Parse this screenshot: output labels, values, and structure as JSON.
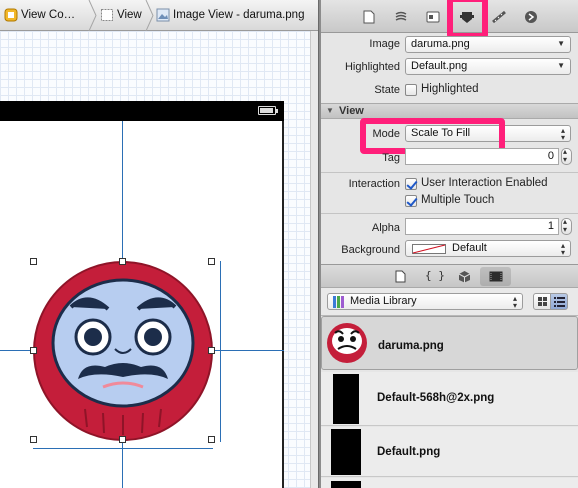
{
  "breadcrumb": [
    {
      "label": "View Co…"
    },
    {
      "label": "View"
    },
    {
      "label": "Image View - daruma.png"
    }
  ],
  "inspector": {
    "image_label": "Image",
    "image_value": "daruma.png",
    "highlighted_label": "Highlighted",
    "highlighted_value": "Default.png",
    "state_label": "State",
    "state_option": "Highlighted",
    "state_checked": false,
    "section_title": "View",
    "mode_label": "Mode",
    "mode_value": "Scale To Fill",
    "tag_label": "Tag",
    "tag_value": "0",
    "interaction_label": "Interaction",
    "user_interaction_label": "User Interaction Enabled",
    "user_interaction_checked": true,
    "multiple_touch_label": "Multiple Touch",
    "multiple_touch_checked": true,
    "alpha_label": "Alpha",
    "alpha_value": "1",
    "background_label": "Background",
    "background_value": "Default"
  },
  "library": {
    "source": "Media Library",
    "items": [
      {
        "name": "daruma.png",
        "selected": true
      },
      {
        "name": "Default-568h@2x.png",
        "selected": false
      },
      {
        "name": "Default.png",
        "selected": false
      }
    ]
  },
  "colors": {
    "highlight": "#ff1f7a",
    "guide": "#2b6fb5",
    "daruma_red": "#c41e3a",
    "daruma_face": "#b7cdf0"
  },
  "icons": [
    "file-inspector-icon",
    "quick-help-icon",
    "identity-inspector-icon",
    "attributes-inspector-icon",
    "size-inspector-icon",
    "connections-inspector-icon",
    "file-template-icon",
    "code-snippet-icon",
    "object-library-icon",
    "media-library-icon"
  ]
}
